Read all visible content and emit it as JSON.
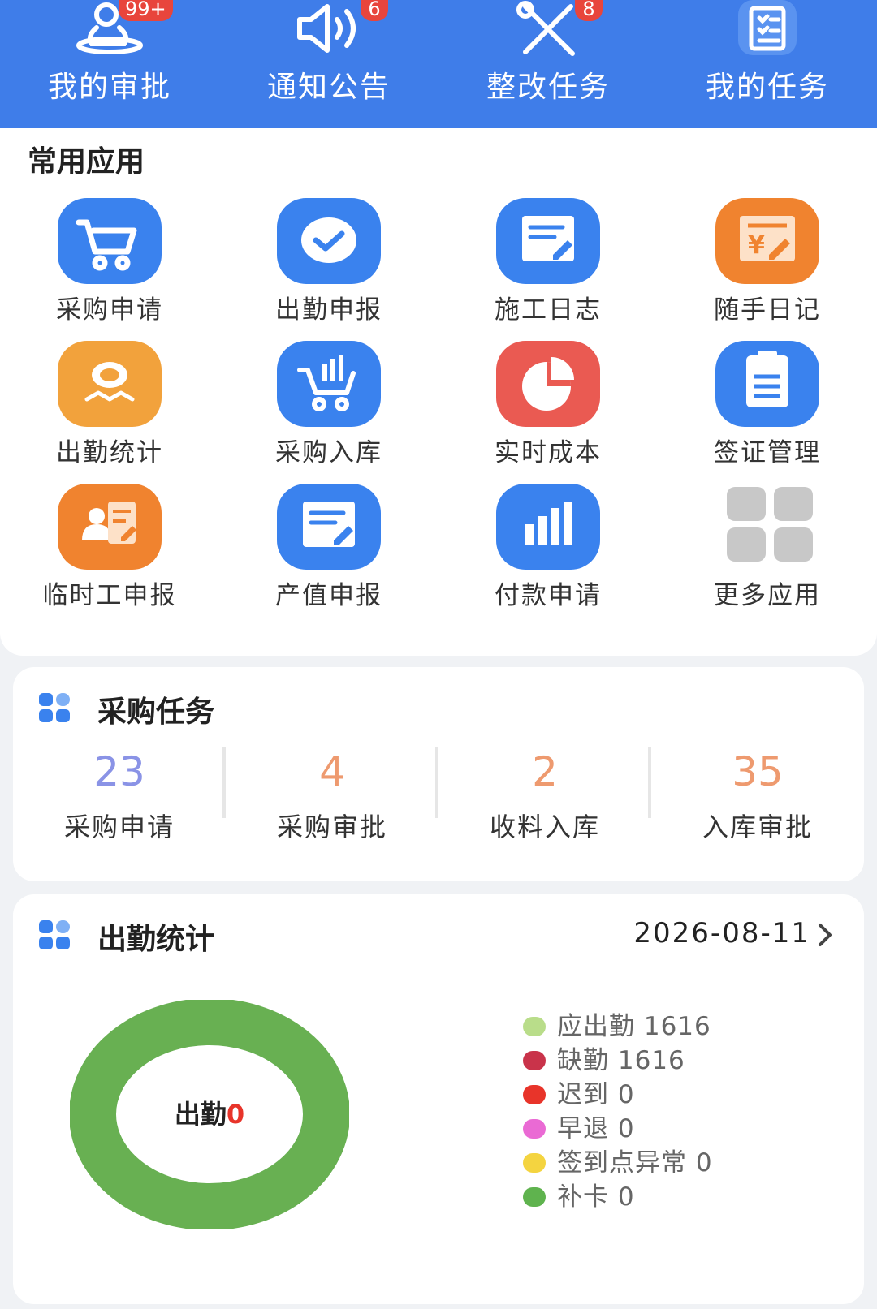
{
  "header": {
    "items": [
      {
        "label": "我的审批",
        "badge": "99+",
        "icon": "approval-person-icon"
      },
      {
        "label": "通知公告",
        "badge": "6",
        "icon": "speaker-icon"
      },
      {
        "label": "整改任务",
        "badge": "8",
        "icon": "tools-icon"
      },
      {
        "label": "我的任务",
        "badge": "",
        "icon": "clipboard-icon"
      }
    ]
  },
  "apps": {
    "title": "常用应用",
    "items": [
      {
        "label": "采购申请",
        "icon": "cart-icon",
        "color": "#3a82ee"
      },
      {
        "label": "出勤申报",
        "icon": "check-bubble-icon",
        "color": "#3a82ee"
      },
      {
        "label": "施工日志",
        "icon": "document-edit-icon",
        "color": "#3a82ee"
      },
      {
        "label": "随手日记",
        "icon": "yen-note-icon",
        "color": "#f0832f"
      },
      {
        "label": "出勤统计",
        "icon": "person-chart-icon",
        "color": "#f2a23c"
      },
      {
        "label": "采购入库",
        "icon": "cart-stock-icon",
        "color": "#3a82ee"
      },
      {
        "label": "实时成本",
        "icon": "pie-icon",
        "color": "#ea5a52"
      },
      {
        "label": "签证管理",
        "icon": "clipboard-list-icon",
        "color": "#3a82ee"
      },
      {
        "label": "临时工申报",
        "icon": "worker-form-icon",
        "color": "#f0832f"
      },
      {
        "label": "产值申报",
        "icon": "document-pen-icon",
        "color": "#3a82ee"
      },
      {
        "label": "付款申请",
        "icon": "bar-chart-icon",
        "color": "#3a82ee"
      },
      {
        "label": "更多应用",
        "icon": "grid-more-icon",
        "color": "#c8c8c8"
      }
    ]
  },
  "purchase": {
    "title": "采购任务",
    "stats": [
      {
        "value": "23",
        "label": "采购申请",
        "color": "#8a93e6"
      },
      {
        "value": "4",
        "label": "采购审批",
        "color": "#ee9a6f"
      },
      {
        "value": "2",
        "label": "收料入库",
        "color": "#ee9a6f"
      },
      {
        "value": "35",
        "label": "入库审批",
        "color": "#ee9a6f"
      }
    ]
  },
  "attendance": {
    "title": "出勤统计",
    "date": "2026-08-11",
    "center_label": "出勤",
    "center_value": "0",
    "legend": [
      {
        "label": "应出勤 1616",
        "color": "#b9dd8a"
      },
      {
        "label": "缺勤 1616",
        "color": "#c9334a"
      },
      {
        "label": "迟到 0",
        "color": "#e8342a"
      },
      {
        "label": "早退 0",
        "color": "#ea6ad4"
      },
      {
        "label": "签到点异常 0",
        "color": "#f4d440"
      },
      {
        "label": "补卡 0",
        "color": "#5fb34e"
      }
    ],
    "ring_color": "#68b052"
  }
}
